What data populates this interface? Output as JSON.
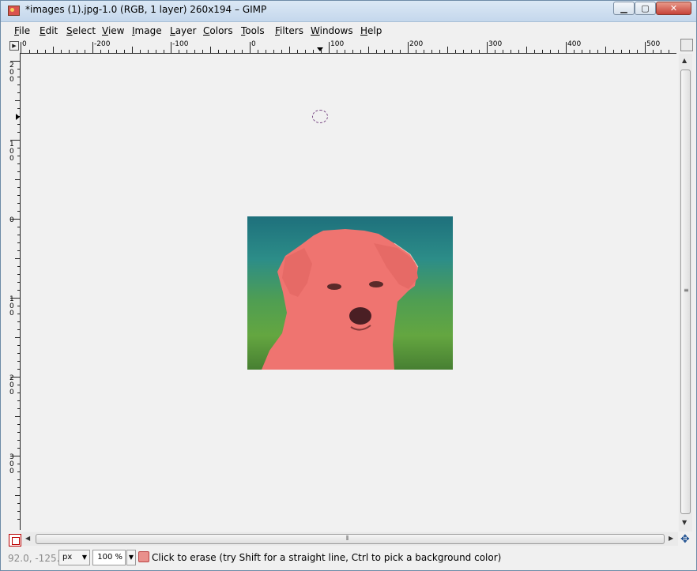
{
  "window": {
    "title": "*images (1).jpg-1.0 (RGB, 1 layer) 260x194 – GIMP",
    "minimize_glyph": "▁",
    "maximize_glyph": "▢",
    "close_glyph": "✕"
  },
  "menubar": {
    "items": [
      "File",
      "Edit",
      "Select",
      "View",
      "Image",
      "Layer",
      "Colors",
      "Tools",
      "Filters",
      "Windows",
      "Help"
    ]
  },
  "rulers": {
    "horizontal_labels": [
      "0",
      "-200",
      "-100",
      "0",
      "100",
      "200",
      "300",
      "400",
      "500"
    ],
    "vertical_labels": [
      "200",
      "100",
      "0",
      "100",
      "200",
      "300"
    ]
  },
  "image": {
    "width": 260,
    "height": 194,
    "subject": "puppy with red eraser overlay",
    "background_colors": [
      "#1e707c",
      "#4f9e52",
      "#64a640"
    ],
    "overlay_color": "#ef7470"
  },
  "statusbar": {
    "coords": "92.0, -125.0",
    "unit": "px",
    "zoom": "100 %",
    "message": "Click to erase (try Shift for a straight line, Ctrl to pick a background color)"
  },
  "icons": {
    "nav_toggle": "▶",
    "navigate": "✥",
    "quick_mask": "quick-mask-icon",
    "tool": "eraser-tool-icon",
    "dropdown": "▼"
  }
}
